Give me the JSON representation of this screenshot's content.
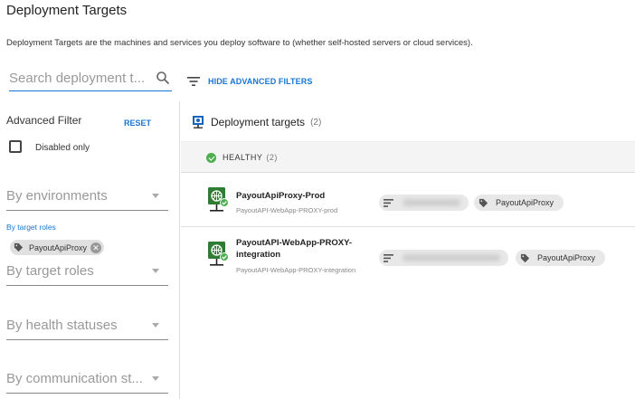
{
  "page": {
    "title": "Deployment Targets",
    "description": "Deployment Targets are the machines and services you deploy software to (whether self-hosted servers or cloud services)."
  },
  "search": {
    "placeholder": "Search deployment t..."
  },
  "filter_toggle": {
    "label": "HIDE ADVANCED FILTERS"
  },
  "advanced_filter": {
    "title": "Advanced Filter",
    "reset_label": "RESET",
    "disabled_only": {
      "label": "Disabled only",
      "checked": false
    },
    "environments": {
      "placeholder": "By environments"
    },
    "target_roles_label": "By target roles",
    "selected_roles": [
      "PayoutApiProxy"
    ],
    "target_roles": {
      "placeholder": "By target roles"
    },
    "health_statuses": {
      "placeholder": "By health statuses"
    },
    "communication_styles": {
      "placeholder": "By communication st..."
    }
  },
  "targets": {
    "title": "Deployment targets",
    "count": "(2)",
    "health_group": {
      "label": "HEALTHY",
      "count": "(2)",
      "color": "#4caf50"
    },
    "machines": [
      {
        "name": "PayoutApiProxy-Prod",
        "subtitle": "PayoutAPI-WebApp-PROXY-prod",
        "role": "PayoutApiProxy",
        "icon": "web-app-icon"
      },
      {
        "name": "PayoutAPI-WebApp-PROXY-integration",
        "subtitle": "PayoutAPI-WebApp-PROXY-integration",
        "role": "PayoutApiProxy",
        "icon": "web-app-icon"
      }
    ]
  },
  "colors": {
    "accent": "#1976d2",
    "healthy": "#4caf50",
    "machine_icon": "#2e7d32"
  }
}
